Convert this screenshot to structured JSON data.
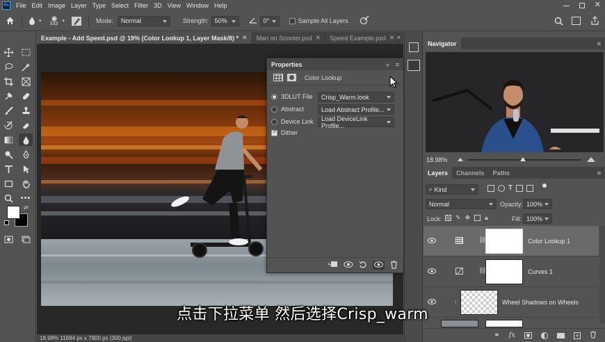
{
  "menu": [
    "File",
    "Edit",
    "Image",
    "Layer",
    "Type",
    "Select",
    "Filter",
    "3D",
    "View",
    "Window",
    "Help"
  ],
  "options": {
    "brush_size": "333",
    "mode_label": "Mode:",
    "mode_value": "Normal",
    "strength_label": "Strength:",
    "strength_value": "50%",
    "angle_value": "0°",
    "sample_all_layers": "Sample All Layers"
  },
  "tabs": [
    {
      "label": "Example - Add Speed.psd @ 19% (Color Lookup 1, Layer Mask/8) *",
      "active": true
    },
    {
      "label": "Man on Scooter.psd",
      "active": false
    },
    {
      "label": "Speed Example.psd",
      "active": false
    }
  ],
  "properties": {
    "title": "Properties",
    "subtitle": "Color Lookup",
    "rows": [
      {
        "label": "3DLUT File",
        "value": "Crisp_Warm.look",
        "selected": true
      },
      {
        "label": "Abstract",
        "value": "Load Abstract Profile...",
        "selected": false
      },
      {
        "label": "Device Link",
        "value": "Load DeviceLink Profile...",
        "selected": false
      }
    ],
    "dither": "Dither"
  },
  "navigator": {
    "title": "Navigator",
    "zoom": "18.98%"
  },
  "layers": {
    "tabs": [
      "Layers",
      "Channels",
      "Paths"
    ],
    "filter_kind": "Kind",
    "blend_mode": "Normal",
    "opacity_label": "Opacity:",
    "opacity_value": "100%",
    "lock_label": "Lock:",
    "fill_label": "Fill:",
    "fill_value": "100%",
    "items": [
      {
        "name": "Color Lookup 1",
        "selected": true
      },
      {
        "name": "Curves 1",
        "selected": false
      },
      {
        "name": "Wheel Shadows on Wheels",
        "selected": false
      }
    ]
  },
  "status": "18.98%   11694 px x 7800 px (300 ppi)",
  "subtitle": "点击下拉菜单 然后选择Crisp_warm",
  "colors": {
    "foreground": "#ffffff",
    "background": "#000000",
    "accent": "#31a8ff"
  }
}
